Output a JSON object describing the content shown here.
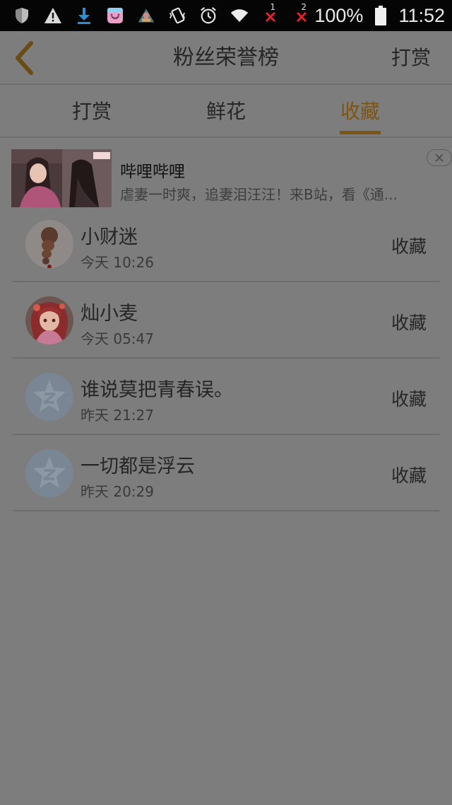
{
  "status_bar": {
    "battery_percent": "100%",
    "time": "11:52",
    "sim1_label": "1",
    "sim2_label": "2",
    "icons": [
      "shield-icon",
      "warning-icon",
      "download-icon",
      "store-bag-icon",
      "game-app-icon",
      "vibrate-icon",
      "alarm-icon",
      "wifi-icon",
      "sim1-no-signal-icon",
      "sim2-no-signal-icon",
      "battery-icon"
    ]
  },
  "header": {
    "title": "粉丝荣誉榜",
    "action_label": "打赏",
    "back_icon": "chevron-left-icon",
    "accent_color": "#7d5512"
  },
  "tabs": [
    {
      "label": "打赏",
      "active": false
    },
    {
      "label": "鲜花",
      "active": false
    },
    {
      "label": "收藏",
      "active": true
    }
  ],
  "ad": {
    "title": "哔哩哔哩",
    "description": "虐妻一时爽，追妻泪汪汪！来B站，看《通...",
    "close_icon": "close-icon"
  },
  "fans": [
    {
      "name": "小财迷",
      "time": "今天 10:26",
      "type": "收藏",
      "avatar": "braid-photo"
    },
    {
      "name": "灿小麦",
      "time": "今天 05:47",
      "type": "收藏",
      "avatar": "anime-girl"
    },
    {
      "name": "谁说莫把青春误。",
      "time": "昨天 21:27",
      "type": "收藏",
      "avatar": "default-star"
    },
    {
      "name": "一切都是浮云",
      "time": "昨天 20:29",
      "type": "收藏",
      "avatar": "default-star"
    }
  ]
}
